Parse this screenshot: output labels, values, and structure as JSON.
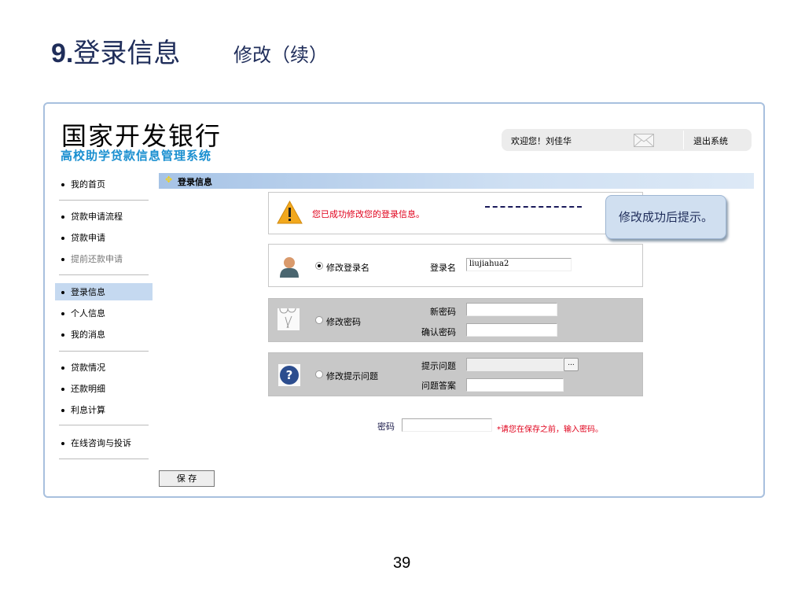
{
  "slide": {
    "number_prefix": "9.",
    "title": "登录信息",
    "subtitle": "修改（续）",
    "page_number": "39"
  },
  "app": {
    "bank_name": "国家开发银行",
    "system_name": "高校助学贷款信息管理系统",
    "welcome": "欢迎您！刘佳华",
    "logout": "退出系统"
  },
  "sidebar": {
    "items": [
      {
        "label": "我的首页"
      },
      {
        "label": "贷款申请流程"
      },
      {
        "label": "贷款申请"
      },
      {
        "label": "提前还款申请"
      },
      {
        "label": "登录信息"
      },
      {
        "label": "个人信息"
      },
      {
        "label": "我的消息"
      },
      {
        "label": "贷款情况"
      },
      {
        "label": "还款明细"
      },
      {
        "label": "利息计算"
      },
      {
        "label": "在线咨询与投诉"
      }
    ]
  },
  "section": {
    "title": "登录信息"
  },
  "success": {
    "message": "您已成功修改您的登录信息。"
  },
  "callout": {
    "text": "修改成功后提示。"
  },
  "login_name": {
    "option": "修改登录名",
    "label": "登录名",
    "value": "liujiahua2"
  },
  "password_change": {
    "option": "修改密码",
    "new_label": "新密码",
    "confirm_label": "确认密码"
  },
  "hint": {
    "option": "修改提示问题",
    "question_label": "提示问题",
    "answer_label": "问题答案",
    "browse": "..."
  },
  "confirm": {
    "label": "密码",
    "note": "*请您在保存之前，输入密码。"
  },
  "save_button": "保 存",
  "colors": {
    "accent": "#1a8fd0",
    "error": "#e0001b",
    "title": "#1f2d5a"
  }
}
